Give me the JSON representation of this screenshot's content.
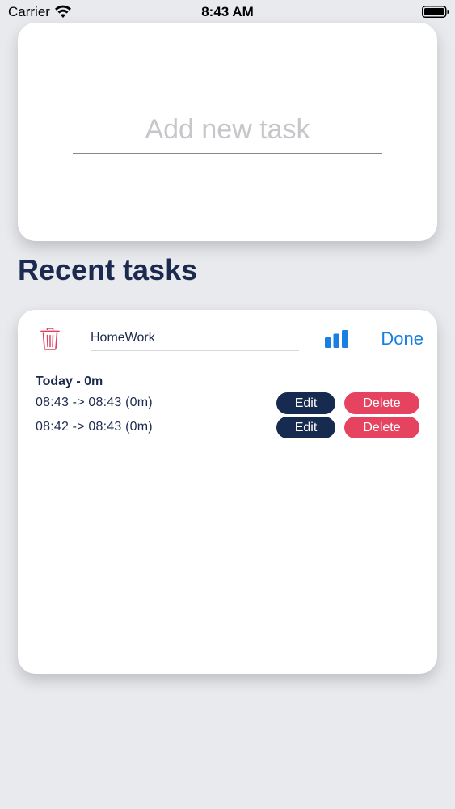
{
  "status_bar": {
    "carrier": "Carrier",
    "time": "8:43 AM",
    "wifi_icon": "wifi-icon",
    "battery_icon": "battery-icon"
  },
  "new_task": {
    "placeholder": "Add new task",
    "value": ""
  },
  "recent": {
    "heading": "Recent tasks"
  },
  "task": {
    "name": "HomeWork",
    "trash_icon": "trash-icon",
    "stats_icon": "bar-chart-icon",
    "done_label": "Done",
    "day_summary": "Today - 0m",
    "entries": [
      {
        "time": "08:43 -> 08:43 (0m)",
        "edit_label": "Edit",
        "delete_label": "Delete"
      },
      {
        "time": "08:42 -> 08:43 (0m)",
        "edit_label": "Edit",
        "delete_label": "Delete"
      }
    ]
  },
  "colors": {
    "background": "#e9eaee",
    "card": "#ffffff",
    "navy": "#172a4f",
    "accent_blue": "#1a7fe0",
    "delete_red": "#e5435f",
    "trash_red": "#e0415f"
  }
}
